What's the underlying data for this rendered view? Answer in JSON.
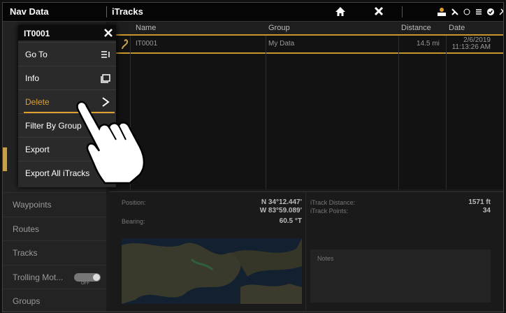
{
  "topbar": {
    "left_title": "Nav Data",
    "center_title": "iTracks"
  },
  "sidebar": {
    "items": [
      {
        "label": "Waypoints"
      },
      {
        "label": "Routes"
      },
      {
        "label": "Tracks"
      },
      {
        "label": "Trolling Mot..."
      },
      {
        "label": "Groups"
      }
    ],
    "toggle_text": "OFF"
  },
  "table": {
    "headers": [
      "Name",
      "Group",
      "Distance",
      "Date"
    ],
    "rows": [
      {
        "name": "IT0001",
        "group": "My Data",
        "distance": "14.5 mi",
        "date": "2/6/2019",
        "time": "11:13:26 AM"
      }
    ]
  },
  "info": {
    "position_label": "Position:",
    "position_lat": "N 34°12.447'",
    "position_lon": "W 83°59.089'",
    "bearing_label": "Bearing:",
    "bearing_value": "60.5 °T",
    "distance_label": "iTrack Distance:",
    "distance_value": "1571 ft",
    "points_label": "iTrack Points:",
    "points_value": "34",
    "notes_label": "Notes"
  },
  "menu": {
    "title": "IT0001",
    "items": [
      {
        "label": "Go To"
      },
      {
        "label": "Info"
      },
      {
        "label": "Delete"
      },
      {
        "label": "Filter By Group"
      },
      {
        "label": "Export"
      },
      {
        "label": "Export All iTracks"
      }
    ]
  },
  "colors": {
    "accent": "#e0a030",
    "table_divider": "#c9962c"
  }
}
